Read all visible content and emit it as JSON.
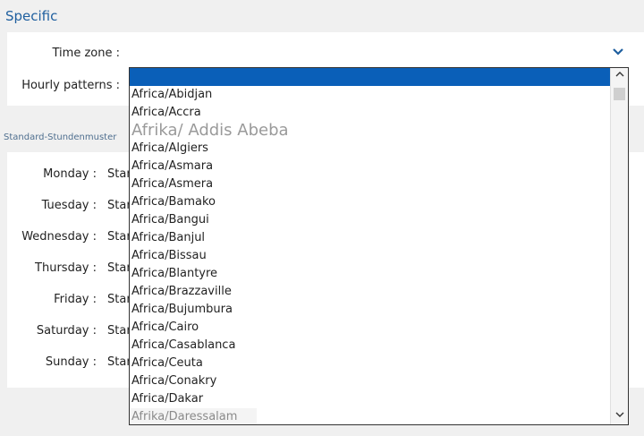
{
  "section_title": "Specific",
  "form": {
    "time_zone_label": "Time zone :",
    "hourly_patterns_label": "Hourly patterns :",
    "chevron_icon": "chevron-down-icon"
  },
  "standard_patterns_title": "Standard-Stundenmuster",
  "days": [
    {
      "label": "Monday :",
      "value": "Stan"
    },
    {
      "label": "Tuesday :",
      "value": "Stan"
    },
    {
      "label": "Wednesday :",
      "value": "Stan"
    },
    {
      "label": "Thursday :",
      "value": "Stan"
    },
    {
      "label": "Friday :",
      "value": "Stan"
    },
    {
      "label": "Saturday :",
      "value": "Stan"
    },
    {
      "label": "Sunday :",
      "value": "Stan"
    }
  ],
  "dropdown": {
    "selected": "",
    "items": [
      "Africa/Abidjan",
      "Africa/Accra",
      "Afrika/ Addis Abeba",
      "Africa/Algiers",
      "Africa/Asmara",
      "Africa/Asmera",
      "Africa/Bamako",
      "Africa/Bangui",
      "Africa/Banjul",
      "Africa/Bissau",
      "Africa/Blantyre",
      "Africa/Brazzaville",
      "Africa/Bujumbura",
      "Africa/Cairo",
      "Africa/Casablanca",
      "Africa/Ceuta",
      "Africa/Conakry",
      "Africa/Dakar",
      "Afrika/Daressalam"
    ]
  },
  "colors": {
    "accent": "#1f5f9f",
    "selection": "#0a5fb8"
  }
}
